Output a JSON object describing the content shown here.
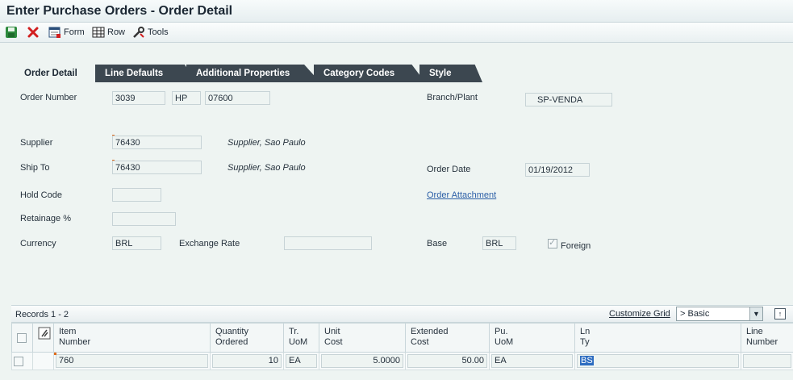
{
  "window": {
    "title": "Enter Purchase Orders - Order Detail"
  },
  "toolbar": {
    "save_icon": "save-icon",
    "cancel_icon": "close-icon",
    "form_label": "Form",
    "row_label": "Row",
    "tools_label": "Tools"
  },
  "tabs": [
    "Order Detail",
    "Line Defaults",
    "Additional Properties",
    "Category Codes",
    "Style"
  ],
  "form": {
    "order_number_label": "Order Number",
    "order_number": "3039",
    "order_type": "HP",
    "order_company": "07600",
    "branch_plant_label": "Branch/Plant",
    "branch_plant": "SP-VENDA",
    "supplier_label": "Supplier",
    "supplier": "76430",
    "supplier_name": "Supplier, Sao Paulo",
    "ship_to_label": "Ship To",
    "ship_to": "76430",
    "ship_to_name": "Supplier, Sao Paulo",
    "order_date_label": "Order Date",
    "order_date": "01/19/2012",
    "hold_code_label": "Hold Code",
    "hold_code": "",
    "order_attachment_link": "Order Attachment",
    "retainage_label": "Retainage %",
    "retainage": "",
    "currency_label": "Currency",
    "currency": "BRL",
    "exchange_rate_label": "Exchange Rate",
    "exchange_rate": "",
    "base_label": "Base",
    "base": "BRL",
    "foreign_label": "Foreign",
    "foreign_checked": true
  },
  "grid": {
    "records_label": "Records 1 - 2",
    "customize_link": "Customize Grid",
    "view_selected": "> Basic",
    "columns": [
      {
        "line1": "Item",
        "line2": "Number"
      },
      {
        "line1": "Quantity",
        "line2": "Ordered"
      },
      {
        "line1": "Tr.",
        "line2": "UoM"
      },
      {
        "line1": "Unit",
        "line2": "Cost"
      },
      {
        "line1": "Extended",
        "line2": "Cost"
      },
      {
        "line1": "Pu.",
        "line2": "UoM"
      },
      {
        "line1": "Ln",
        "line2": "Ty"
      },
      {
        "line1": "Line",
        "line2": "Number"
      }
    ],
    "row": {
      "item_number": "760",
      "quantity": "10",
      "tr_uom": "EA",
      "unit_cost": "5.0000",
      "extended_cost": "50.00",
      "pu_uom": "EA",
      "ln_ty": "BS",
      "line_number": ""
    }
  }
}
